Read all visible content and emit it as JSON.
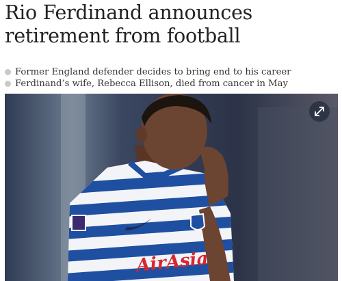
{
  "article": {
    "headline": "Rio Ferdinand announces retirement from football",
    "standfirst": [
      "Former England defender decides to bring end to his career",
      "Ferdinand’s wife, Rebecca Ellison, died from cancer in May"
    ]
  },
  "photo": {
    "shirt_sponsor": "AirAsia",
    "expand_icon": "expand-arrows-icon",
    "colors": {
      "background": "#3c4a63",
      "stripe_blue": "#1f4fa0",
      "stripe_white": "#f3f4f8",
      "skin": "#6b4432",
      "sponsor_red": "#d8262e"
    }
  }
}
